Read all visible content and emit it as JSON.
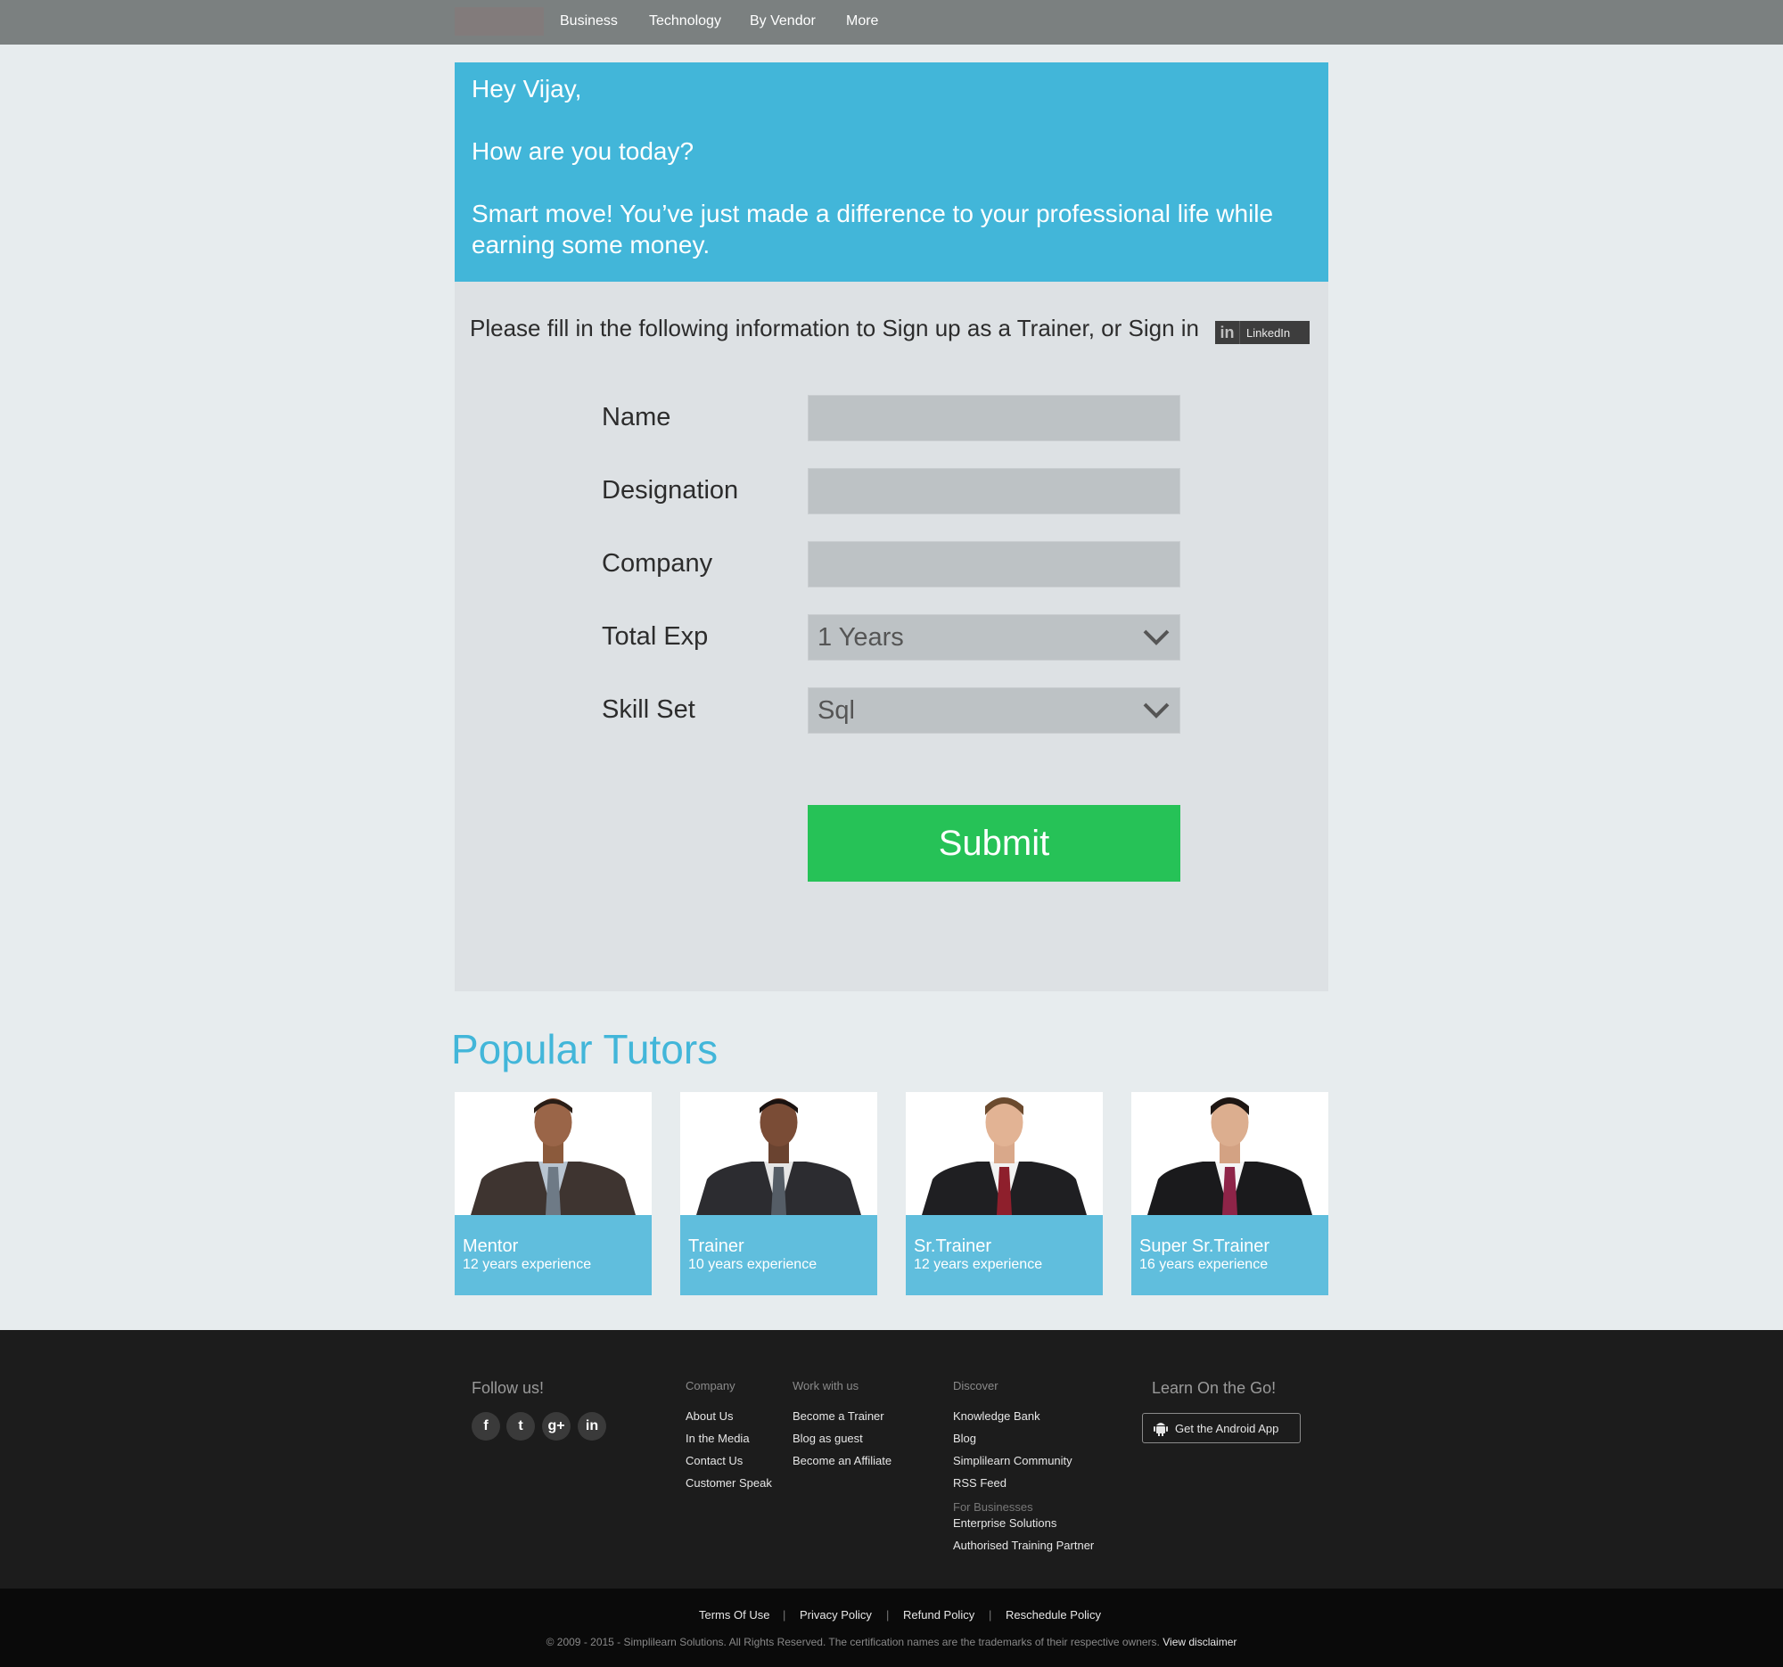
{
  "nav": {
    "items": [
      "Business",
      "Technology",
      "By Vendor",
      "More"
    ]
  },
  "hero": {
    "greeting": "Hey Vijay,",
    "question": "How are you today?",
    "message": "Smart move! You’ve just made a difference to your professional life while earning some money."
  },
  "form": {
    "intro": "Please fill in the following information to Sign up as a Trainer, or Sign in",
    "linkedin_label": "LinkedIn",
    "name_label": "Name",
    "name_value": "",
    "designation_label": "Designation",
    "designation_value": "",
    "company_label": "Company",
    "company_value": "",
    "total_exp_label": "Total Exp",
    "total_exp_value": "1 Years",
    "skill_set_label": "Skill Set",
    "skill_set_value": "Sql",
    "submit_label": "Submit"
  },
  "tutors": {
    "title": "Popular Tutors",
    "cards": [
      {
        "role": "Mentor",
        "experience": "12 years experience",
        "tie": "#6e7a86",
        "suit": "#3e3430"
      },
      {
        "role": "Trainer",
        "experience": "10 years experience",
        "tie": "#555d66",
        "suit": "#2c2c30"
      },
      {
        "role": "Sr.Trainer",
        "experience": "12 years experience",
        "tie": "#8e1f2c",
        "suit": "#1f1f22"
      },
      {
        "role": "Super Sr.Trainer",
        "experience": "16 years experience",
        "tie": "#8e2448",
        "suit": "#1a1a1c"
      }
    ]
  },
  "footer": {
    "follow_label": "Follow us!",
    "social": [
      "f",
      "t",
      "g+",
      "in"
    ],
    "company_head": "Company",
    "company_links": [
      "About Us",
      "In the Media",
      "Contact Us",
      "Customer Speak"
    ],
    "work_head": "Work with us",
    "work_links": [
      "Become a Trainer",
      "Blog as guest",
      "Become an Affiliate"
    ],
    "discover_head": "Discover",
    "discover_links": [
      "Knowledge Bank",
      "Blog",
      "Simplilearn Community",
      "RSS Feed"
    ],
    "business_head": "For Businesses",
    "business_links": [
      "Enterprise Solutions",
      "Authorised Training Partner"
    ],
    "go_label": "Learn On the Go!",
    "android_label": "Get the Android App",
    "legal_links": [
      "Terms Of Use",
      "Privacy Policy",
      "Refund Policy",
      "Reschedule Policy"
    ],
    "copyright": "© 2009 - 2015 - Simplilearn Solutions. All Rights Reserved. The certification names are the trademarks of their respective owners.",
    "disclaimer": "View disclaimer"
  }
}
